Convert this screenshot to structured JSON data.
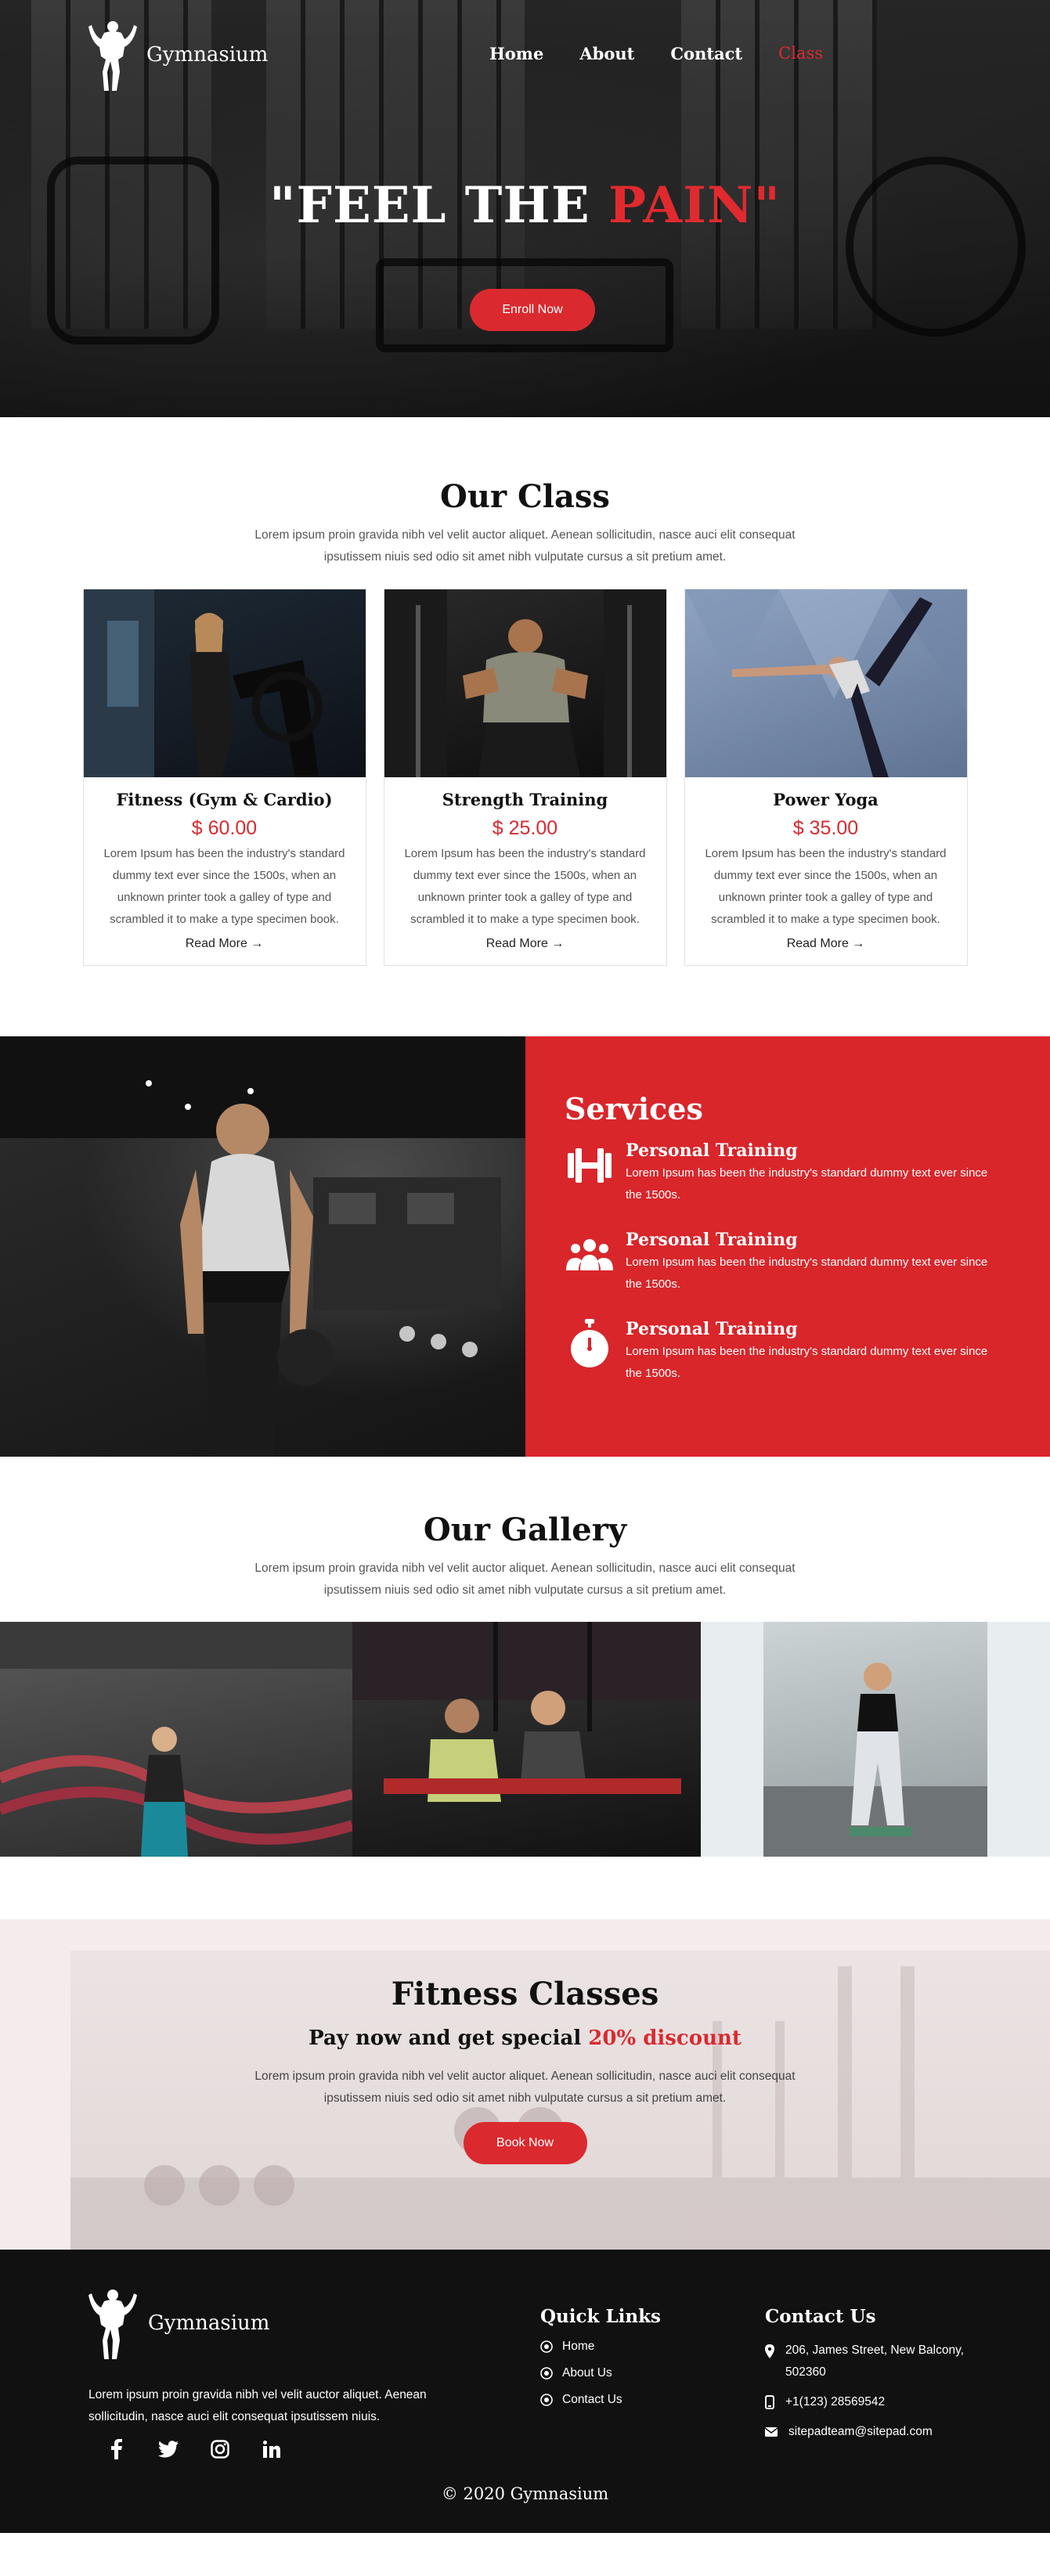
{
  "brand": {
    "name": "Gymnasium"
  },
  "nav": [
    {
      "label": "Home",
      "active": false
    },
    {
      "label": "About",
      "active": false
    },
    {
      "label": "Contact",
      "active": false
    },
    {
      "label": "Class",
      "active": true
    }
  ],
  "hero": {
    "title_white": "\"FEEL THE ",
    "title_red": "PAIN\"",
    "button": "Enroll Now"
  },
  "our_class": {
    "title": "Our Class",
    "intro": "Lorem ipsum proin gravida nibh vel velit auctor aliquet. Aenean sollicitudin, nasce auci elit consequat ipsutissem niuis sed odio sit amet nibh vulputate cursus a sit pretium amet.",
    "cards": [
      {
        "name": "Fitness (Gym & Cardio)",
        "price": "$ 60.00",
        "text": "Lorem Ipsum has been the industry's standard dummy text ever since the 1500s, when an unknown printer took a galley of type and scrambled it to make a type specimen book.",
        "link": "Read More →"
      },
      {
        "name": "Strength Training",
        "price": "$ 25.00",
        "text": "Lorem Ipsum has been the industry's standard dummy text ever since the 1500s, when an unknown printer took a galley of type and scrambled it to make a type specimen book.",
        "link": "Read More →"
      },
      {
        "name": "Power Yoga",
        "price": "$ 35.00",
        "text": "Lorem Ipsum has been the industry's standard dummy text ever since the 1500s, when an unknown printer took a galley of type and scrambled it to make a type specimen book.",
        "link": "Read More →"
      }
    ]
  },
  "services": {
    "title": "Services",
    "items": [
      {
        "icon": "dumbbell-icon",
        "title": "Personal Training",
        "text": "Lorem Ipsum has been the industry's standard dummy text ever since the 1500s."
      },
      {
        "icon": "users-icon",
        "title": "Personal Training",
        "text": "Lorem Ipsum has been the industry's standard dummy text ever since the 1500s."
      },
      {
        "icon": "stopwatch-icon",
        "title": "Personal Training",
        "text": "Lorem Ipsum has been the industry's standard dummy text ever since the 1500s."
      }
    ]
  },
  "gallery": {
    "title": "Our Gallery",
    "intro": "Lorem ipsum proin gravida nibh vel velit auctor aliquet. Aenean sollicitudin, nasce auci elit consequat ipsutissem niuis sed odio sit amet nibh vulputate cursus a sit pretium amet."
  },
  "fitness": {
    "title": "Fitness Classes",
    "subtitle_main": "Pay now and get special ",
    "subtitle_red": "20% discount",
    "text": "Lorem ipsum proin gravida nibh vel velit auctor aliquet. Aenean sollicitudin, nasce auci elit consequat ipsutissem niuis sed odio sit amet nibh vulputate cursus a sit pretium amet.",
    "button": "Book Now"
  },
  "footer": {
    "about": "Lorem ipsum proin gravida nibh vel velit auctor aliquet. Aenean sollicitudin, nasce auci elit consequat ipsutissem niuis.",
    "quick_links_title": "Quick Links",
    "quick_links": [
      "Home",
      "About Us",
      "Contact Us"
    ],
    "contact_title": "Contact Us",
    "address": "206, James Street, New Balcony, 502360",
    "phone": "+1(123) 28569542",
    "email": "sitepadteam@sitepad.com",
    "socials": [
      "facebook-icon",
      "twitter-icon",
      "instagram-icon",
      "linkedin-icon"
    ],
    "copyright": "© 2020 Gymnasium"
  },
  "colors": {
    "accent": "#da2a2f",
    "footer_bg": "#111111"
  }
}
